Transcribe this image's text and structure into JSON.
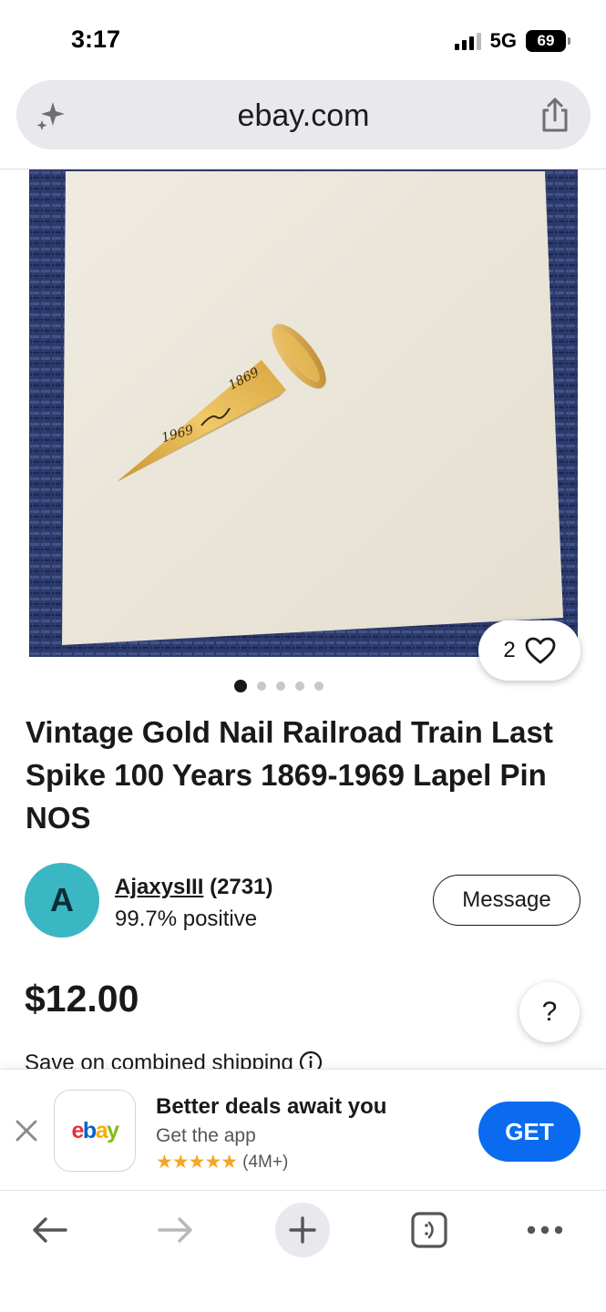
{
  "status_bar": {
    "time": "3:17",
    "network": "5G",
    "battery": "69"
  },
  "address_bar": {
    "url": "ebay.com"
  },
  "listing": {
    "watch_count": "2",
    "image_count": 5,
    "active_image": 1,
    "image_text": {
      "year_top": "1869",
      "year_bottom": "1969"
    },
    "title": "Vintage Gold Nail Railroad Train Last Spike 100 Years 1869-1969 Lapel Pin NOS",
    "seller": {
      "avatar_letter": "A",
      "username": "AjaxysIII",
      "feedback_count": "(2731)",
      "positive": "99.7% positive",
      "message_label": "Message"
    },
    "price": "$12.00",
    "help_label": "?",
    "shipping_note": "Save on combined shipping"
  },
  "app_banner": {
    "logo_letters": [
      "e",
      "b",
      "a",
      "y"
    ],
    "title": "Better deals await you",
    "subtitle": "Get the app",
    "stars": "★★★★★",
    "rating_count": "(4M+)",
    "cta": "GET"
  },
  "toolbar": {
    "icons": [
      "back-arrow-icon",
      "forward-arrow-icon",
      "plus-icon",
      "tabs-icon",
      "more-icon"
    ]
  },
  "colors": {
    "accent_blue": "#0a6bf0",
    "avatar_teal": "#3ab7c2",
    "star_gold": "#f5a623",
    "mat_navy": "#2b3a6a",
    "card_cream": "#ede8dc"
  }
}
